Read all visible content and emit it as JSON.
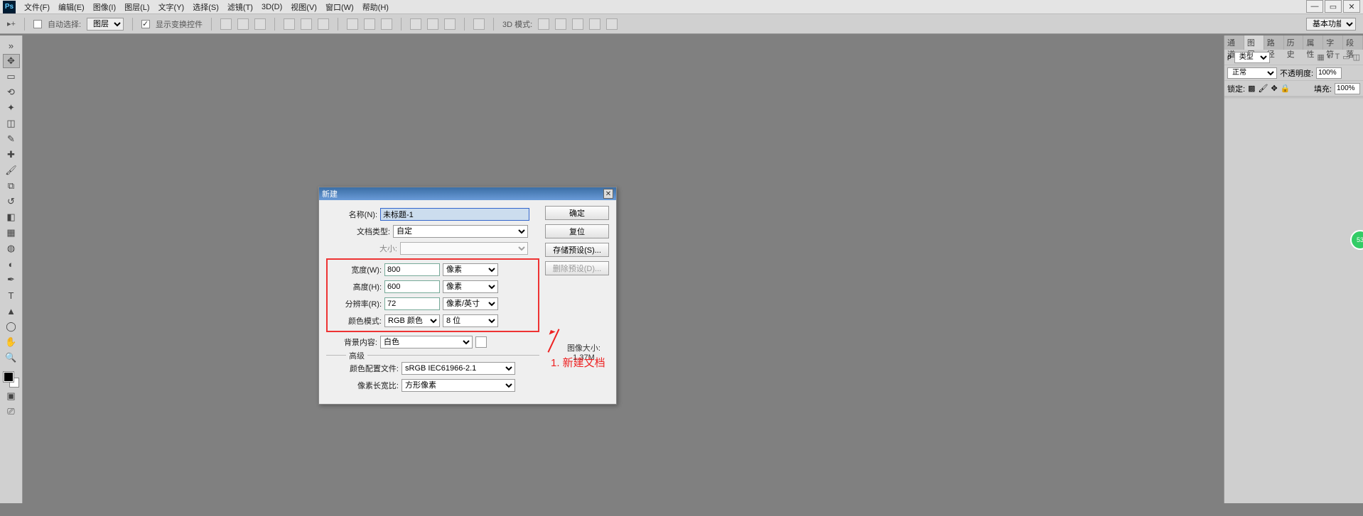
{
  "menubar": {
    "logo": "Ps",
    "items": [
      "文件(F)",
      "编辑(E)",
      "图像(I)",
      "图层(L)",
      "文字(Y)",
      "选择(S)",
      "滤镜(T)",
      "3D(D)",
      "视图(V)",
      "窗口(W)",
      "帮助(H)"
    ]
  },
  "optbar": {
    "auto_select_label": "自动选择:",
    "auto_select_value": "图层",
    "show_transform_label": "显示变换控件",
    "mode3d_label": "3D 模式:",
    "workspace": "基本功能"
  },
  "rpanel": {
    "tabs": [
      "通道",
      "图层",
      "路径",
      "历史",
      "属性",
      "字符",
      "段落"
    ],
    "kind_label": "类型",
    "blend_mode": "正常",
    "opacity_label": "不透明度:",
    "opacity_value": "100%",
    "lock_label": "锁定:",
    "fill_label": "填充:",
    "fill_value": "100%"
  },
  "dialog": {
    "title": "新建",
    "name_label": "名称(N):",
    "name_value": "未标题-1",
    "doc_type_label": "文档类型:",
    "doc_type_value": "自定",
    "size_label": "大小:",
    "width_label": "宽度(W):",
    "width_value": "800",
    "width_unit": "像素",
    "height_label": "高度(H):",
    "height_value": "600",
    "height_unit": "像素",
    "res_label": "分辨率(R):",
    "res_value": "72",
    "res_unit": "像素/英寸",
    "color_mode_label": "颜色模式:",
    "color_mode_value": "RGB 颜色",
    "color_depth": "8 位",
    "bg_label": "背景内容:",
    "bg_value": "白色",
    "advanced_label": "高级",
    "profile_label": "颜色配置文件:",
    "profile_value": "sRGB IEC61966-2.1",
    "aspect_label": "像素长宽比:",
    "aspect_value": "方形像素",
    "imgsize_label": "图像大小:",
    "imgsize_value": "1.37M",
    "btn_ok": "确定",
    "btn_reset": "复位",
    "btn_save": "存储预设(S)...",
    "btn_delete": "删除预设(D)..."
  },
  "annotation": "1. 新建文档",
  "bubble": "53"
}
